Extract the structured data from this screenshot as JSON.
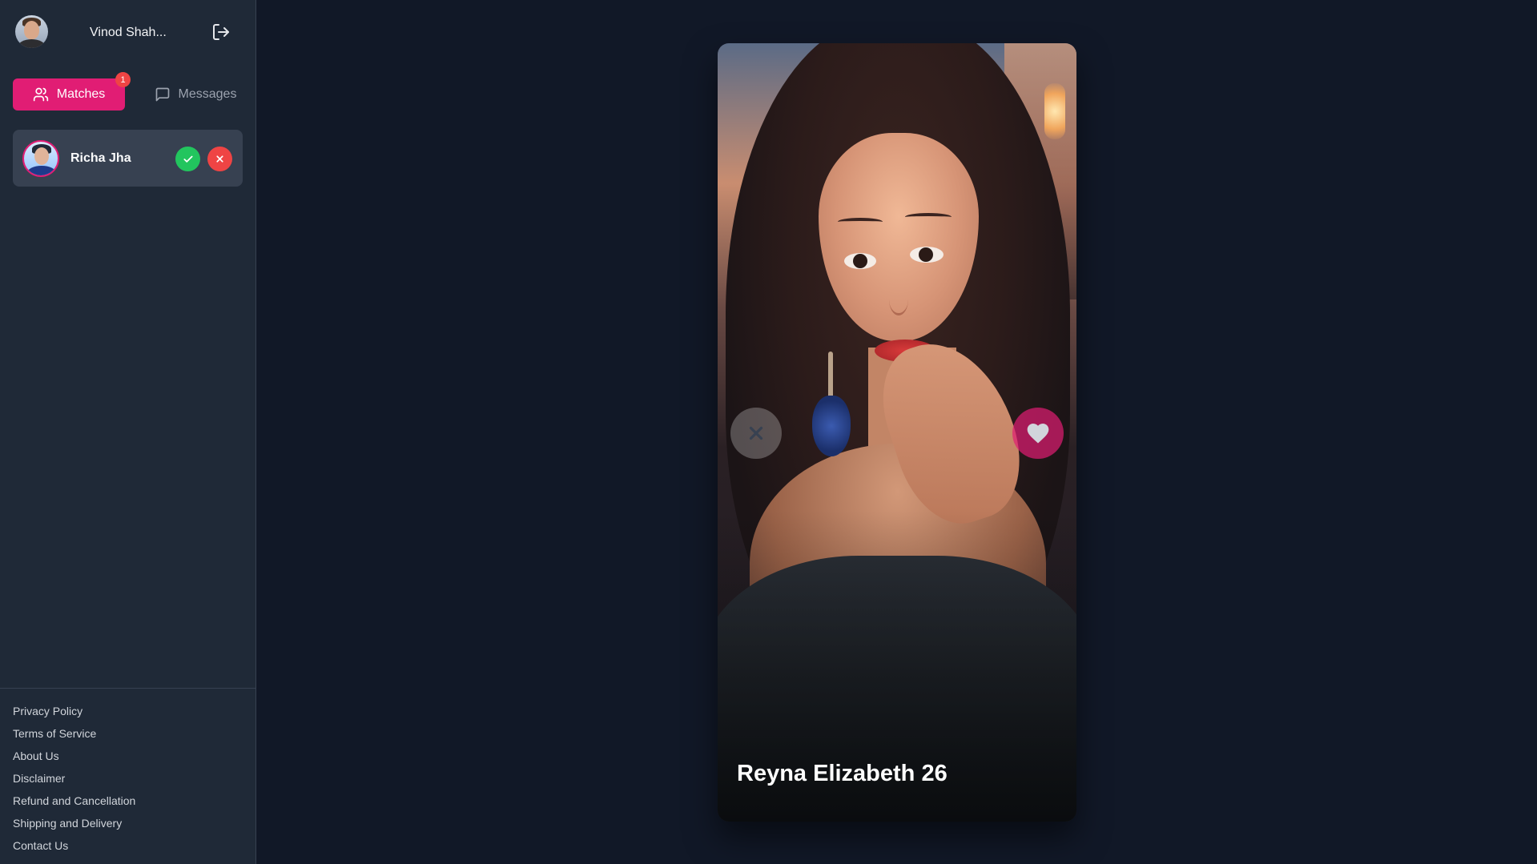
{
  "user": {
    "name": "Vinod Shah..."
  },
  "tabs": {
    "matches_label": "Matches",
    "matches_badge": "1",
    "messages_label": "Messages"
  },
  "matches": [
    {
      "name": "Richa Jha"
    }
  ],
  "footer": {
    "links": [
      "Privacy Policy",
      "Terms of Service",
      "About Us",
      "Disclaimer",
      "Refund and Cancellation",
      "Shipping and Delivery",
      "Contact Us"
    ]
  },
  "card": {
    "name_age": "Reyna Elizabeth 26"
  },
  "colors": {
    "background": "#111827",
    "sidebar": "#1f2937",
    "accent": "#e11d74",
    "accept": "#22c55e",
    "reject": "#ef4444"
  },
  "icons": {
    "logout": "logout-icon",
    "matches": "users-icon",
    "messages": "message-icon",
    "accept": "check-icon",
    "reject": "close-icon",
    "pass": "close-icon",
    "like": "heart-icon"
  }
}
